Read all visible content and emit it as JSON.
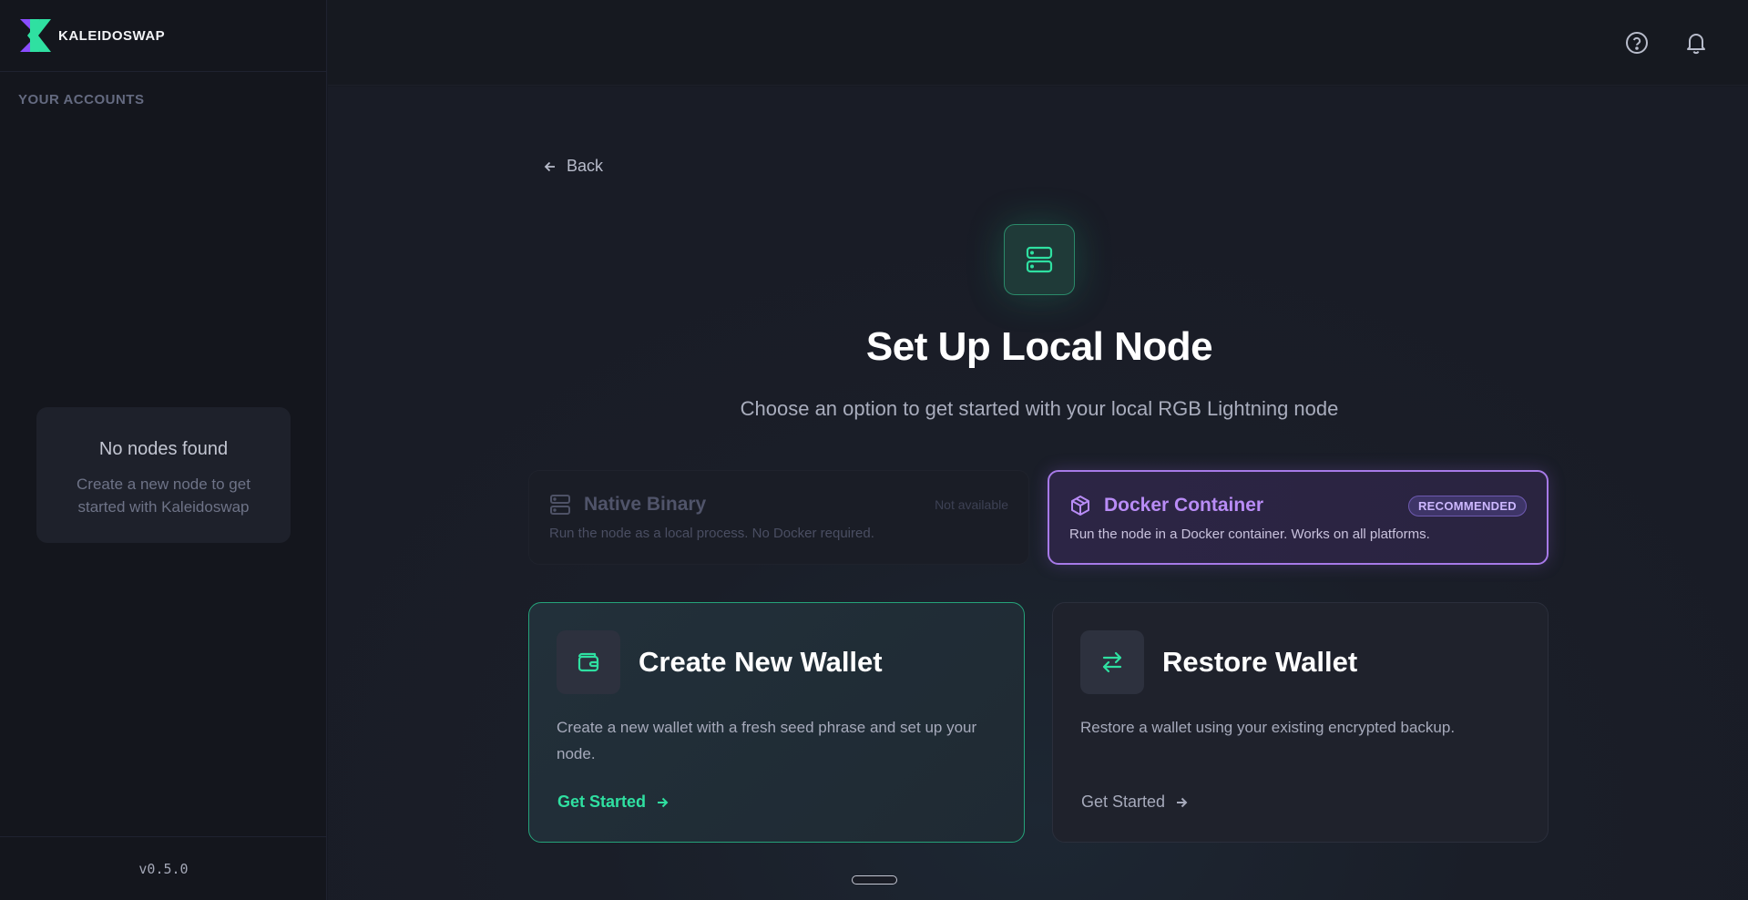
{
  "brand": {
    "name": "KALEIDOSWAP",
    "logo_colors": {
      "purple": "#8a4dff",
      "green": "#2fe0a1"
    }
  },
  "sidebar": {
    "section_title": "YOUR ACCOUNTS",
    "empty": {
      "title": "No nodes found",
      "description": "Create a new node to get started with Kaleidoswap"
    },
    "version": "v0.5.0"
  },
  "topbar": {
    "icons": [
      "help-icon",
      "bell-icon"
    ]
  },
  "main": {
    "back_label": "Back",
    "title": "Set Up Local Node",
    "subtitle": "Choose an option to get started with your local RGB Lightning node",
    "options": {
      "native": {
        "title": "Native Binary",
        "status": "Not available",
        "description": "Run the node as a local process. No Docker required."
      },
      "docker": {
        "title": "Docker Container",
        "badge": "RECOMMENDED",
        "description": "Run the node in a Docker container. Works on all platforms."
      }
    },
    "actions": {
      "create": {
        "title": "Create New Wallet",
        "description": "Create a new wallet with a fresh seed phrase and set up your node.",
        "cta": "Get Started"
      },
      "restore": {
        "title": "Restore Wallet",
        "description": "Restore a wallet using your existing encrypted backup.",
        "cta": "Get Started"
      }
    }
  },
  "colors": {
    "accent_green": "#2fe0a1",
    "accent_purple": "#a77ae8",
    "background": "#161922"
  }
}
